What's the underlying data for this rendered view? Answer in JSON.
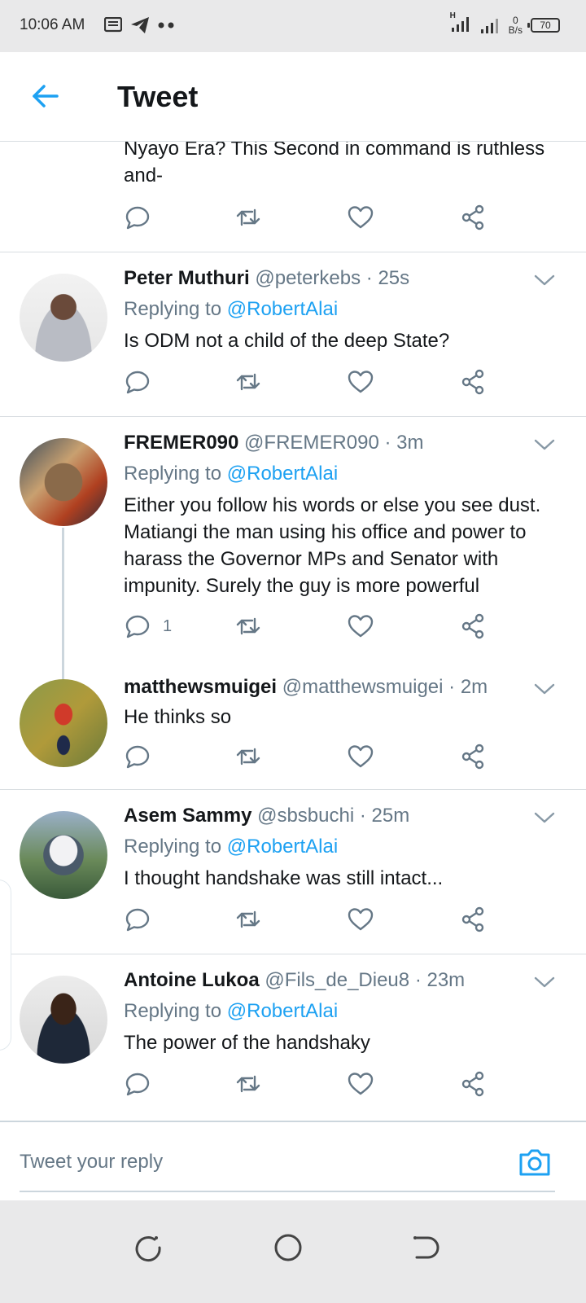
{
  "status_bar": {
    "time": "10:06 AM",
    "network_speed_value": "0",
    "network_speed_unit": "B/s",
    "signal_label": "H",
    "battery": "70"
  },
  "header": {
    "title": "Tweet"
  },
  "partial_tweet": {
    "text": "Nyayo Era? This Second in command is ruthless and-"
  },
  "tweets": [
    {
      "name": "Peter Muthuri",
      "handle": "@peterkebs",
      "time": "· 25s",
      "replying_label": "Replying to",
      "replying_to": "@RobertAlai",
      "text": "Is ODM not a child of the deep State?"
    },
    {
      "name": "FREMER090",
      "handle": "@FREMER090",
      "time": "· 3m",
      "replying_label": "Replying to",
      "replying_to": "@RobertAlai",
      "text": "Either you follow his words or else you see dust. Matiangi the man using his office and power to harass the Governor   MPs and Senator with impunity. Surely the guy is more powerful",
      "reply_count": "1"
    },
    {
      "name": "matthewsmuigei",
      "handle": "@matthewsmuigei",
      "time": "· 2m",
      "text": "He thinks so"
    },
    {
      "name": "Asem Sammy",
      "handle": "@sbsbuchi",
      "time": "· 25m",
      "replying_label": "Replying to",
      "replying_to": "@RobertAlai",
      "text": "I thought handshake was still intact..."
    },
    {
      "name": "Antoine Lukoa",
      "handle": "@Fils_de_Dieu8",
      "time": "· 23m",
      "replying_label": "Replying to",
      "replying_to": "@RobertAlai",
      "text": "The power of the handshaky"
    }
  ],
  "reply_bar": {
    "placeholder": "Tweet your reply"
  },
  "colors": {
    "accent": "#1da1f2",
    "muted": "#657786",
    "text": "#14171a",
    "divider": "#d8dde1"
  }
}
